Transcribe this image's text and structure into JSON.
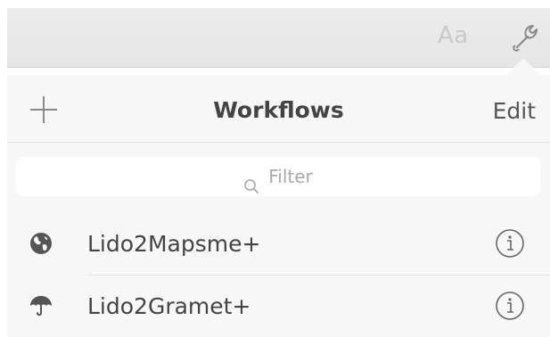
{
  "toolbar": {
    "font_button_label": "Aa",
    "settings_icon": "wrench-icon"
  },
  "popover": {
    "add_icon": "plus-icon",
    "title": "Workflows",
    "edit_label": "Edit",
    "search": {
      "icon": "search-icon",
      "placeholder": "Filter"
    },
    "workflows": [
      {
        "name": "Lido2Mapsme+",
        "icon": "globe-icon",
        "info_icon": "info-icon"
      },
      {
        "name": "Lido2Gramet+",
        "icon": "umbrella-icon",
        "info_icon": "info-icon"
      }
    ]
  },
  "colors": {
    "toolbar_bg": "#e8e8e8",
    "popover_bg": "#f7f7f7",
    "text": "#444444",
    "muted": "#a9a9a9"
  }
}
